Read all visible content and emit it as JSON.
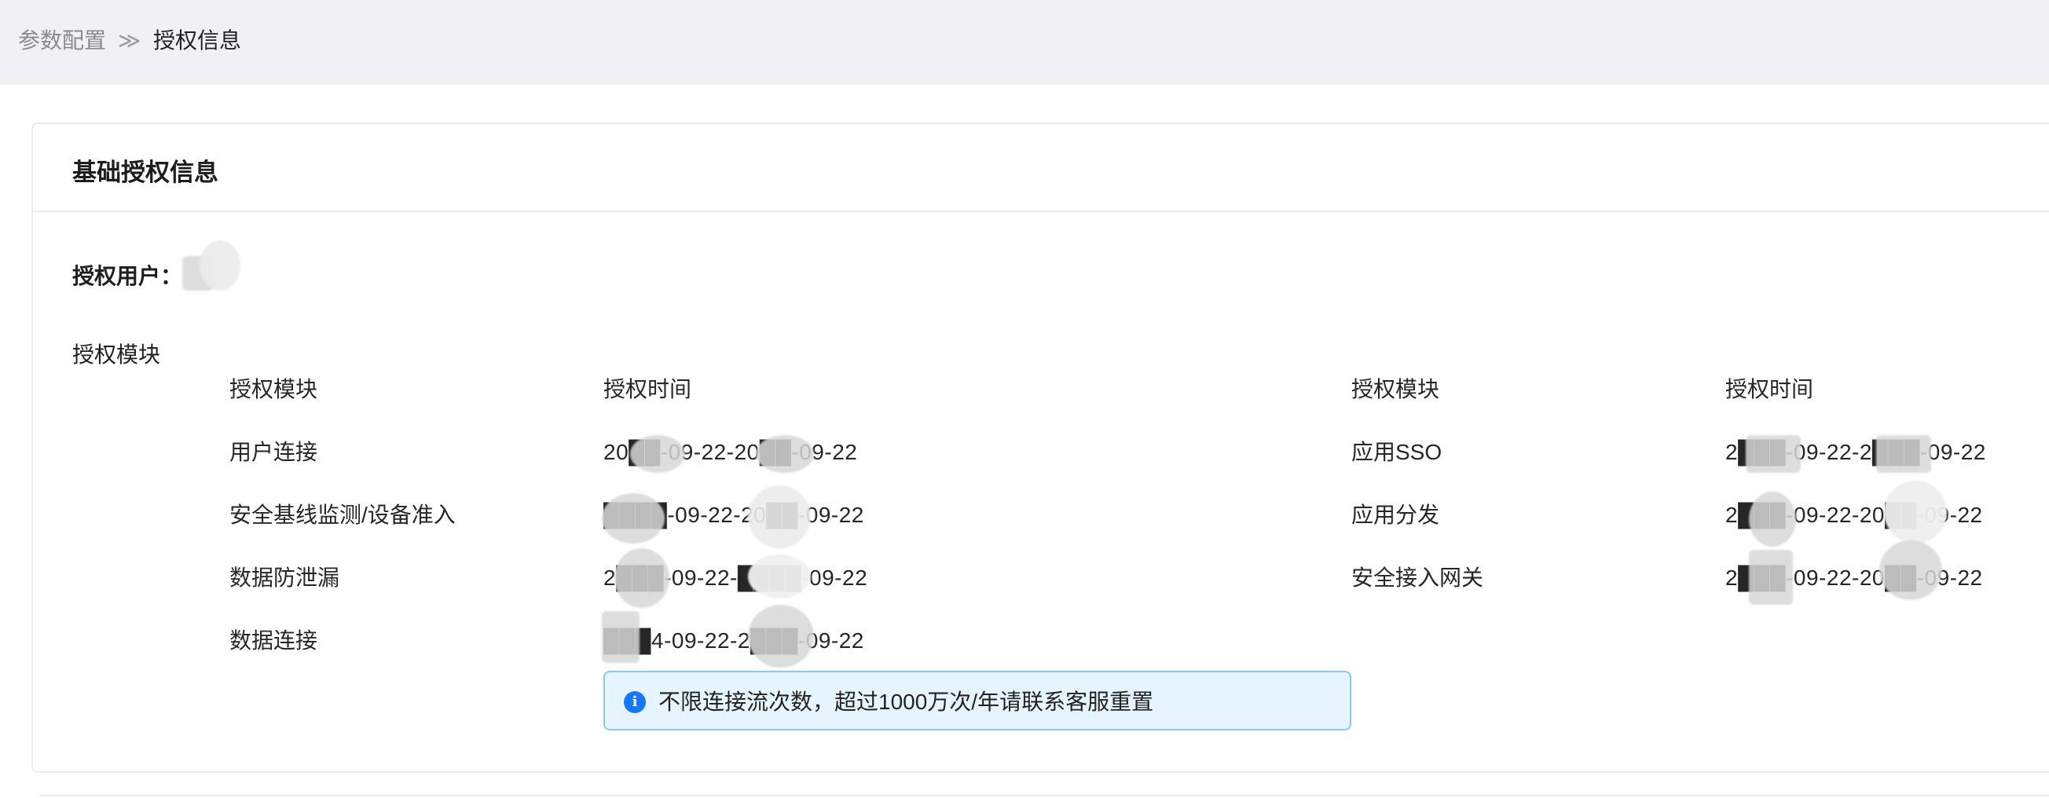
{
  "breadcrumb": {
    "parent": "参数配置",
    "separator": "≫",
    "current": "授权信息"
  },
  "card": {
    "title": "基础授权信息",
    "user_label": "授权用户：",
    "modules_label": "授权模块"
  },
  "left_table": {
    "headers": [
      "授权模块",
      "授权时间"
    ],
    "rows": [
      {
        "module": "用户连接",
        "time": "20██-09-22-20██-09-22"
      },
      {
        "module": "安全基线监测/设备准入",
        "time": "████-09-22-20██-09-22"
      },
      {
        "module": "数据防泄漏",
        "time": "2███-09-22-████-09-22"
      },
      {
        "module": "数据连接",
        "time": "███4-09-22-2███-09-22"
      }
    ]
  },
  "right_table": {
    "headers": [
      "授权模块",
      "授权时间"
    ],
    "rows": [
      {
        "module": "应用SSO",
        "time": "2███-09-22-2███-09-22"
      },
      {
        "module": "应用分发",
        "time": "2███-09-22-20██-09-22"
      },
      {
        "module": "安全接入网关",
        "time": "2███-09-22-20██-09-22"
      }
    ]
  },
  "notice": {
    "icon": "info-icon",
    "text": "不限连接流次数，超过1000万次/年请联系客服重置",
    "accent": "#1677ff"
  }
}
